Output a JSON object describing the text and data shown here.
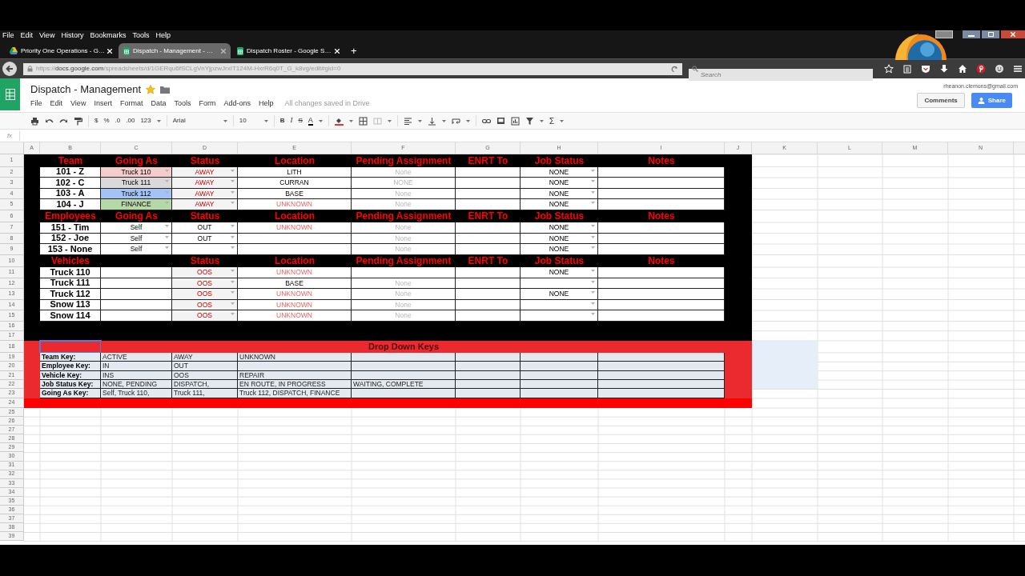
{
  "browser": {
    "menu": [
      "File",
      "Edit",
      "View",
      "History",
      "Bookmarks",
      "Tools",
      "Help"
    ],
    "tabs": [
      {
        "title": "Priority One Operations - G…",
        "kind": "drive",
        "selected": false
      },
      {
        "title": "Dispatch - Management - …",
        "kind": "sheets",
        "selected": true
      },
      {
        "title": "Dispatch Roster - Google S…",
        "kind": "sheets",
        "selected": false
      }
    ],
    "new_tab": "+",
    "url": "https://**docs.google.com**/spreadsheets/d/1GERqu6fSCLgVnYjpzwJrxIT124M-HxrR6q0T_G_k8vg/edit#gid=0",
    "search": {
      "placeholder": "Search"
    }
  },
  "app": {
    "title": "Dispatch - Management",
    "starred": true,
    "menus": [
      "File",
      "Edit",
      "View",
      "Insert",
      "Format",
      "Data",
      "Tools",
      "Form",
      "Add-ons",
      "Help"
    ],
    "save_status": "All changes saved in Drive",
    "account": "rheanon.clemons@gmail.com",
    "buttons": [
      "Comments",
      "Share"
    ],
    "toolbar": {
      "currency": "$",
      "percent": "%",
      "decrease_decimal": ".0",
      "increase_decimal": ".00",
      "more_formats": "123",
      "font": "Arial",
      "font_size": "10",
      "bold": "B",
      "italic": "I",
      "strikethrough": "S",
      "text_color": "A",
      "functions": "Σ"
    },
    "formula_label": "fx"
  },
  "sheet": {
    "columns": [
      "A",
      "B",
      "C",
      "D",
      "E",
      "F",
      "G",
      "H",
      "I",
      "J",
      "K",
      "L",
      "M",
      "N"
    ],
    "rows": [
      {
        "number": "1",
        "kind": "header",
        "color": "#000000",
        "cells": {
          "B": {
            "text": "Team"
          },
          "C": {
            "text": "Going As"
          },
          "D": {
            "text": "Status"
          },
          "E": {
            "text": "Location"
          },
          "F": {
            "text": "Pending Assignment"
          },
          "G": {
            "text": "ENRT To"
          },
          "H": {
            "text": "Job Status"
          },
          "I": {
            "text": "Notes"
          }
        }
      },
      {
        "number": "2",
        "kind": "data",
        "color": "#000000",
        "cells": {
          "B": {
            "text": "101 - Z",
            "kind": "label"
          },
          "C": {
            "text": "Truck 110",
            "kind": "value",
            "color": "#f4cccc",
            "dropdown": true
          },
          "D": {
            "text": "AWAY",
            "kind": "status",
            "color": "#f3f3f3",
            "dropdown": true
          },
          "E": {
            "text": "LITH",
            "kind": "value"
          },
          "F": {
            "text": "None",
            "kind": "none"
          },
          "H": {
            "text": "NONE",
            "kind": "value",
            "dropdown": true
          }
        }
      },
      {
        "number": "3",
        "kind": "data",
        "color": "#000000",
        "cells": {
          "B": {
            "text": "102 - C",
            "kind": "label"
          },
          "C": {
            "text": "Truck 111",
            "kind": "value",
            "color": "#d9d9d9",
            "dropdown": true
          },
          "D": {
            "text": "AWAY",
            "kind": "status",
            "color": "#f3f3f3",
            "dropdown": true
          },
          "E": {
            "text": "CURRAN",
            "kind": "value"
          },
          "F": {
            "text": "NONE",
            "kind": "none"
          },
          "H": {
            "text": "NONE",
            "kind": "value",
            "dropdown": true
          }
        }
      },
      {
        "number": "4",
        "kind": "data",
        "color": "#000000",
        "cells": {
          "B": {
            "text": "103 - A",
            "kind": "label"
          },
          "C": {
            "text": "Truck 112",
            "kind": "value",
            "color": "#a4c2f4",
            "dropdown": true
          },
          "D": {
            "text": "AWAY",
            "kind": "status",
            "color": "#f3f3f3",
            "dropdown": true
          },
          "E": {
            "text": "BASE",
            "kind": "value"
          },
          "F": {
            "text": "None",
            "kind": "none"
          },
          "H": {
            "text": "NONE",
            "kind": "value",
            "dropdown": true
          }
        }
      },
      {
        "number": "5",
        "kind": "data",
        "color": "#000000",
        "cells": {
          "B": {
            "text": "104 - J",
            "kind": "label"
          },
          "C": {
            "text": "FINANCE",
            "kind": "value",
            "color": "#b6d7a8",
            "dropdown": true
          },
          "D": {
            "text": "AWAY",
            "kind": "status",
            "color": "#f3f3f3",
            "dropdown": true
          },
          "E": {
            "text": "UNKNOWN",
            "kind": "unknown"
          },
          "F": {
            "text": "None",
            "kind": "none"
          },
          "H": {
            "text": "NONE",
            "kind": "value",
            "dropdown": true
          }
        }
      },
      {
        "number": "6",
        "kind": "header",
        "color": "#000000",
        "cells": {
          "B": {
            "text": "Employees"
          },
          "C": {
            "text": "Going As"
          },
          "D": {
            "text": "Status"
          },
          "E": {
            "text": "Location"
          },
          "F": {
            "text": "Pending Assignment"
          },
          "G": {
            "text": "ENRT To"
          },
          "H": {
            "text": "Job Status"
          },
          "I": {
            "text": "Notes"
          }
        }
      },
      {
        "number": "7",
        "kind": "data",
        "color": "#000000",
        "cells": {
          "B": {
            "text": "151 - Tim",
            "kind": "label"
          },
          "C": {
            "text": "Self",
            "kind": "value",
            "dropdown": true
          },
          "D": {
            "text": "OUT",
            "kind": "value",
            "dropdown": true
          },
          "E": {
            "text": "UNKNOWN",
            "kind": "unknown"
          },
          "F": {
            "text": "None",
            "kind": "none"
          },
          "H": {
            "text": "NONE",
            "kind": "value",
            "dropdown": true
          }
        }
      },
      {
        "number": "8",
        "kind": "data",
        "color": "#000000",
        "cells": {
          "B": {
            "text": "152 - Joe",
            "kind": "label"
          },
          "C": {
            "text": "Self",
            "kind": "value",
            "dropdown": true
          },
          "D": {
            "text": "OUT",
            "kind": "value",
            "dropdown": true
          },
          "F": {
            "text": "None",
            "kind": "none"
          },
          "H": {
            "text": "NONE",
            "kind": "value",
            "dropdown": true
          }
        }
      },
      {
        "number": "9",
        "kind": "data",
        "color": "#000000",
        "cells": {
          "B": {
            "text": "153 - None",
            "kind": "label"
          },
          "C": {
            "text": "Self",
            "kind": "value",
            "dropdown": true
          },
          "D": {
            "dropdown": true
          },
          "F": {
            "text": "None",
            "kind": "none"
          },
          "H": {
            "text": "NONE",
            "kind": "value",
            "dropdown": true
          }
        }
      },
      {
        "number": "10",
        "kind": "header",
        "color": "#000000",
        "cells": {
          "B": {
            "text": "Vehicles"
          },
          "D": {
            "text": "Status"
          },
          "E": {
            "text": "Location"
          },
          "F": {
            "text": "Pending Assignment"
          },
          "G": {
            "text": "ENRT To"
          },
          "H": {
            "text": "Job Status"
          },
          "I": {
            "text": "Notes"
          }
        }
      },
      {
        "number": "11",
        "kind": "data",
        "color": "#000000",
        "cells": {
          "B": {
            "text": "Truck 110",
            "kind": "label"
          },
          "D": {
            "text": "OOS",
            "kind": "status",
            "color": "#f3f3f3",
            "dropdown": true
          },
          "E": {
            "text": "UNKNOWN",
            "kind": "unknown"
          },
          "H": {
            "text": "NONE",
            "kind": "value",
            "dropdown": true
          }
        }
      },
      {
        "number": "12",
        "kind": "data",
        "color": "#000000",
        "cells": {
          "B": {
            "text": "Truck 111",
            "kind": "label"
          },
          "D": {
            "text": "OOS",
            "kind": "status",
            "color": "#f3f3f3",
            "dropdown": true
          },
          "E": {
            "text": "BASE",
            "kind": "value"
          },
          "F": {
            "text": "None",
            "kind": "none"
          },
          "H": {
            "dropdown": true
          }
        }
      },
      {
        "number": "13",
        "kind": "data",
        "color": "#000000",
        "cells": {
          "B": {
            "text": "Truck 112",
            "kind": "label"
          },
          "D": {
            "text": "OOS",
            "kind": "status",
            "color": "#f3f3f3",
            "dropdown": true
          },
          "E": {
            "text": "UNKNOWN",
            "kind": "unknown"
          },
          "F": {
            "text": "None",
            "kind": "none"
          },
          "H": {
            "text": "NONE",
            "kind": "value",
            "dropdown": true
          }
        }
      },
      {
        "number": "14",
        "kind": "data",
        "color": "#000000",
        "cells": {
          "B": {
            "text": "Snow 113",
            "kind": "label"
          },
          "D": {
            "text": "OOS",
            "kind": "status",
            "color": "#f3f3f3",
            "dropdown": true
          },
          "E": {
            "text": "UNKNOWN",
            "kind": "unknown"
          },
          "F": {
            "text": "None",
            "kind": "none"
          },
          "H": {
            "dropdown": true
          }
        }
      },
      {
        "number": "15",
        "kind": "data",
        "color": "#000000",
        "cells": {
          "B": {
            "text": "Snow 114",
            "kind": "label"
          },
          "D": {
            "text": "OOS",
            "kind": "status",
            "color": "#f3f3f3",
            "dropdown": true
          },
          "E": {
            "text": "UNKNOWN",
            "kind": "unknown"
          },
          "F": {
            "text": "None",
            "kind": "none"
          },
          "H": {
            "dropdown": true
          }
        }
      },
      {
        "number": "16",
        "kind": "band",
        "color": "#000000",
        "cells": {}
      },
      {
        "number": "17",
        "kind": "band",
        "color": "#000000",
        "cells": {}
      },
      {
        "number": "18",
        "kind": "title",
        "color": "#ea2a2f",
        "cells": {
          "B": {
            "selected": true
          },
          "F": {
            "text": "Drop Down Keys"
          },
          "K": {
            "color": "#e6eef9"
          }
        }
      },
      {
        "number": "19",
        "kind": "key",
        "color": "#ea2a2f",
        "cells": {
          "B": {
            "text": "Team Key:",
            "kind": "label"
          },
          "C": {
            "text": "ACTIVE"
          },
          "D": {
            "text": "AWAY"
          },
          "E": {
            "text": "UNKNOWN"
          },
          "K": {
            "color": "#e6eef9"
          }
        }
      },
      {
        "number": "20",
        "kind": "key",
        "color": "#ea2a2f",
        "cells": {
          "B": {
            "text": "Employee Key:",
            "kind": "label"
          },
          "C": {
            "text": "IN"
          },
          "D": {
            "text": "OUT"
          },
          "K": {
            "color": "#e6eef9"
          }
        }
      },
      {
        "number": "21",
        "kind": "key",
        "color": "#ea2a2f",
        "cells": {
          "B": {
            "text": "Vehicle Key:",
            "kind": "label"
          },
          "C": {
            "text": "INS"
          },
          "D": {
            "text": "OOS"
          },
          "E": {
            "text": "REPAIR"
          },
          "K": {
            "color": "#e6eef9"
          }
        }
      },
      {
        "number": "22",
        "kind": "key",
        "color": "#ea2a2f",
        "cells": {
          "B": {
            "text": "Job Status Key:",
            "kind": "label"
          },
          "C": {
            "text": "NONE, PENDING"
          },
          "D": {
            "text": "DISPATCH,"
          },
          "E": {
            "text": "EN ROUTE, IN PROGRESS"
          },
          "F": {
            "text": "WAITING, COMPLETE"
          },
          "K": {
            "color": "#e6eef9"
          }
        }
      },
      {
        "number": "23",
        "kind": "key",
        "color": "#ea2a2f",
        "cells": {
          "B": {
            "text": "Going As Key:",
            "kind": "label"
          },
          "C": {
            "text": "Self, Truck 110,"
          },
          "D": {
            "text": "Truck 111,"
          },
          "E": {
            "text": "Truck 112, DISPATCH, FINANCE"
          }
        }
      },
      {
        "number": "24",
        "kind": "band",
        "color": "#ff0000",
        "cells": {}
      },
      {
        "number": "25",
        "kind": "empty",
        "cells": {}
      },
      {
        "number": "26",
        "kind": "empty",
        "cells": {}
      },
      {
        "number": "27",
        "kind": "empty",
        "cells": {}
      },
      {
        "number": "28",
        "kind": "empty",
        "cells": {}
      },
      {
        "number": "29",
        "kind": "empty",
        "cells": {}
      },
      {
        "number": "30",
        "kind": "empty",
        "cells": {}
      },
      {
        "number": "31",
        "kind": "empty",
        "cells": {}
      },
      {
        "number": "32",
        "kind": "empty",
        "cells": {}
      },
      {
        "number": "33",
        "kind": "empty",
        "cells": {}
      },
      {
        "number": "34",
        "kind": "empty",
        "cells": {}
      },
      {
        "number": "35",
        "kind": "empty",
        "cells": {}
      },
      {
        "number": "36",
        "kind": "empty",
        "cells": {}
      },
      {
        "number": "37",
        "kind": "empty",
        "cells": {}
      },
      {
        "number": "38",
        "kind": "empty",
        "cells": {}
      },
      {
        "number": "39",
        "kind": "empty",
        "cells": {}
      }
    ]
  }
}
